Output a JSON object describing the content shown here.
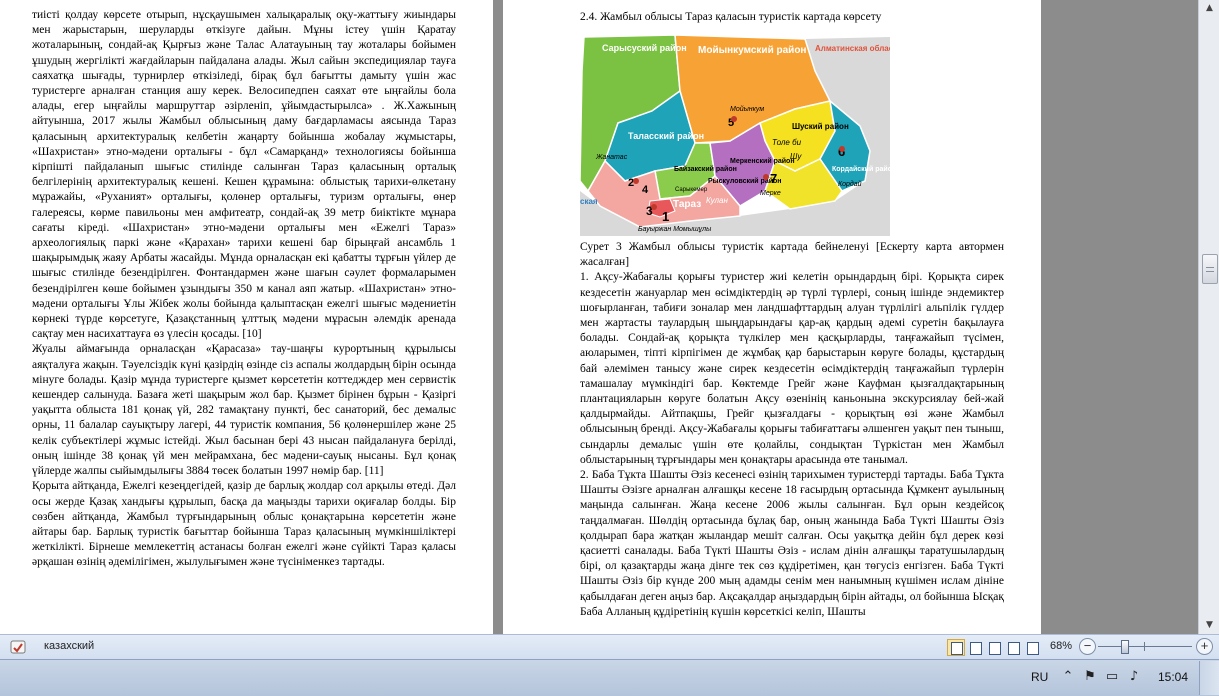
{
  "left_page": {
    "paragraphs": [
      "тиісті қолдау көрсете отырып, нұсқаушымен халықаралық оқу-жаттығу жиындары мен жарыстарын, шеруларды өткізуге дайын. Мұны істеу үшін Қаратау жоталарының, сондай-ақ Қырғыз және Талас Алатауының тау жоталары бойымен ұшудың жергілікті жағдайларын пайдалана алады. Жыл сайын экспедициялар тауға саяхатқа шығады, турнирлер өткізіледі, бірақ бұл бағытты дамыту үшін жас туристерге арналған станция ашу керек. Велосипедпен саяхат өте ыңғайлы бола алады, егер ыңғайлы маршруттар әзірленіп, ұйымдастырылса» . Ж.Хажының айтуынша, 2017 жылы Жамбыл облысының даму бағдарламасы аясында Тараз қаласының архитектуралық келбетін жаңарту бойынша жобалау жұмыстары, «Шахристан» этно-мәдени орталығы - бұл «Самарқанд» технологиясы бойынша кірпішті пайдаланып шығыс стилінде салынған Тараз қаласының орталық белгілерінің архитектуралық кешені. Кешен құрамына: облыстық тарихи-өлкетану мұражайы, «Руханият» орталығы, қолөнер орталығы, туризм орталығы, өнер галереясы, көрме павильоны мен амфитеатр, сондай-ақ 39 метр биіктікте мұнара сағаты кіреді. «Шахристан» этно-мәдени орталығы мен «Ежелгі Тараз» археологиялық паркі және «Қарахан» тарихи кешені бар бірыңғай ансамбль 1 шақырымдық жаяу Арбаты жасайды. Мұнда орналасқан екі қабатты тұрғын үйлер де шығыс стилінде безендірілген. Фонтандармен және шағын сәулет формаларымен безендірілген көше бойымен ұзындығы 350 м канал аяп жатыр. «Шахристан» этно-мәдени орталығы Ұлы Жібек жолы бойында қалыптасқан ежелгі шығыс мәдениетін көрнекі түрде көрсетуге, Қазақстанның ұлттық мәдени мұрасын әлемдік аренада сақтау мен насихаттауға өз үлесін қосады. [10]",
      "Жуалы аймағында орналасқан «Қарасаза» тау-шаңғы курортының құрылысы аяқталуға жақын. Тәуелсіздік күні қазірдің өзінде сіз аспалы жолдардың бірін осында мінуге болады. Қазір мұнда туристерге қызмет көрсететін коттедждер мен сервистік кешендер салынуда. Базаға жеті шақырым жол бар. Қызмет бірінен бұрын - Қазіргі уақытта облыста 181 қонақ үй, 282 тамақтану пункті, бес санаторий, бес демалыс орны, 11 балалар сауықтыру лагері, 44 туристік компания, 56 қолөнершілер және 25 келік субъектілері жұмыс істейді. Жыл басынан бері 43 нысан пайдалануға берілді, оның ішінде 38 қонақ үй мен мейрамхана, бес мәдени-сауық нысаны. Бұл қонақ үйлерде жалпы сыйымдылығы 3884 төсек болатын 1997 нөмір бар. [11]",
      "Қорыта айтқанда, Ежелгі кезеңдегідей, қазір де барлық жолдар сол арқылы өтеді. Дәл осы жерде Қазақ хандығы құрылып, басқа да маңызды тарихи оқиғалар болды. Бір сөзбен айтқанда, Жамбыл түрғындарының облыс қонақтарына көрсететін және айтары бар. Барлық туристік бағыттар бойынша Тараз қаласының мүмкіншіліктері жеткілікті. Бірнеше мемлекеттің астанасы болған ежелгі және сүйікті Тараз қаласы әрқашан өзінің әдемілігімен, жылулығымен және түсініменкез тартады."
    ]
  },
  "right_page": {
    "heading": "2.4. Жамбыл облысы Тараз қаласын туристік картада көрсету",
    "map": {
      "labels": {
        "sarysu": "Сарысуский район",
        "moiynkum": "Мойынкумский район",
        "almaty": "Алматинская область",
        "talas": "Таласский район",
        "shu": "Шуский район",
        "kordai": "Кордайский район",
        "merke": "Меркенский район",
        "ryskulov": "Рыскуловский район",
        "baizak": "Байзакский район",
        "zhualy": "Жуалынский район",
        "tole_bi": "Толе би",
        "taraz": "Тараз",
        "kulan": "Кулан",
        "shu_city": "Шу",
        "zhanatas": "Жанатас",
        "moiynkum_town": "Мойынкум",
        "saryker": "Сарыкемер",
        "kordai_town": "Кордай",
        "merke_town": "Мерке",
        "bauyrzhan": "Бауыржан Момышұлы",
        "region_edge": "ская",
        "markers": [
          "1",
          "2",
          "3",
          "4",
          "5",
          "6",
          "7"
        ]
      },
      "colors": {
        "sarysu": "#7cc242",
        "moiynkum": "#f7a234",
        "talas": "#1fa3b8",
        "shu": "#f5e11f",
        "kordai": "#1fa3b8",
        "merke": "#f0e32a",
        "ryskulov": "#b56fc1",
        "baizak": "#8ccc4c",
        "zhualy": "#f4a7a0",
        "taraz": "#e8585a",
        "outside": "#d9d9d9"
      }
    },
    "caption": "Сурет 3 Жамбыл облысы туристік картада бейнеленуі [Ескерту карта автормен жасалған]",
    "paragraphs": [
      "1. Ақсу-Жабағалы қорығы туристер жиі келетін орындардың бірі. Қорықта сирек кездесетін жануарлар мен өсімдіктердің әр түрлі түрлері, соның ішінде эндемиктер шоғырланған, табиғи зоналар мен ландшафттардың алуан түрлілігі альпілік гүлдер мен жартасты таулардың шыңдарындағы қар-ақ қардың әдемі суретін бақылауға болады. Сондай-ақ қорықта түлкілер мен қасқырларды, таңғажайып түсімен, аюларымен, тіпті кірпігімен де жұмбақ қар барыстарын көруге болады, құстардың бай әлемімен танысу және сирек кездесетін өсімдіктердің таңғажайып түрлерін тамашалау мүмкіндігі бар. Көктемде Грейг және Кауфман қызғалдақтарының плантацияларын көруге болатын Ақсу өзенінің каньонына экскурсиялау бей-жай қалдырмайды. Айтпақшы, Грейг қызғалдағы - қорықтың өзі және Жамбыл облысының бренді. Ақсу-Жабағалы қорығы табиғаттағы әлшенген уақыт пен тыныш, сындарлы демалыс үшін өте қолайлы, сондықтан Түркістан мен Жамбыл облыстарының тұрғындары мен қонақтары арасында өте танымал.",
      "2. Баба Тұкта Шашты Әзіз кесенесі өзінің тарихымен туристерді тартады. Баба Тұкта Шашты Әзізге арналған алғашқы кесене 18 ғасырдың ортасында Құмкент ауылының маңында салынған. Жаңа кесене 2006 жылы салынған. Бұл орын кездейсоқ таңдалмаған. Шөлдің ортасында бұлақ бар, оның жанында Баба Түкті Шашты Әзіз қолдырап бара жатқан жыландар мешіт салған. Осы уақытқа дейін бұл дерек көзі қасиетті саналады. Баба Түкті Шашты Әзіз - ислам дінін алғашқы таратушылардың бірі, ол қазақтарды жаңа дінге тек сөз құдіретімен, қан төгусіз енгізген. Баба Түкті Шашты Әзіз бір күнде 200 мың адамды сенім мен нанымның күшімен ислам дініне қабылдаған деген аңыз бар. Ақсақалдар аңыздардың бірін айтады, ол бойынша Ысқақ Баба Алланың құдіретінің күшін көрсеткісі келіп, Шашты"
    ]
  },
  "status_bar": {
    "language": "казахский",
    "zoom": "68%",
    "zoom_fraction": 0.28,
    "view_buttons": [
      "print-layout",
      "full-screen-reading",
      "web-layout",
      "outline",
      "draft"
    ]
  },
  "taskbar": {
    "input_language": "RU",
    "time": "15:04"
  }
}
